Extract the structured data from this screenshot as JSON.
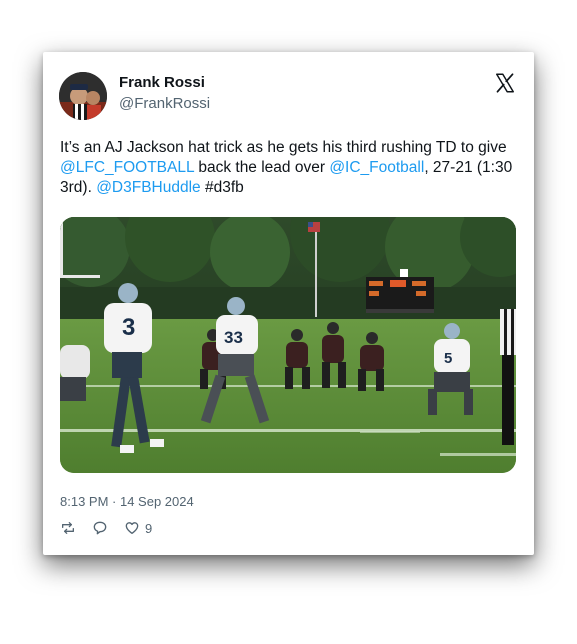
{
  "author": {
    "name": "Frank Rossi",
    "handle": "@FrankRossi",
    "avatar_icon": "avatar-photo"
  },
  "platform_icon": "x-logo-icon",
  "tweet": {
    "text_1": "It’s an AJ Jackson hat trick as he gets his third rushing TD to give ",
    "mention_1": "@LFC_FOOTBALL",
    "text_2": " back the lead over ",
    "mention_2": "@IC_Football",
    "text_3": ", 27-21 (1:30 3rd). ",
    "mention_3": "@D3FBHuddle",
    "text_4": " #d3fb"
  },
  "media": {
    "description_icon": "football-game-photo",
    "player_numbers": [
      "3",
      "33",
      "5"
    ]
  },
  "timestamp": "8:13 PM · 14 Sep 2024",
  "actions": {
    "repost_icon": "repost-icon",
    "reply_icon": "reply-icon",
    "like_icon": "heart-icon",
    "like_count": "9"
  },
  "colors": {
    "link": "#1d9bf0",
    "text": "#0f1419",
    "muted": "#536471"
  }
}
